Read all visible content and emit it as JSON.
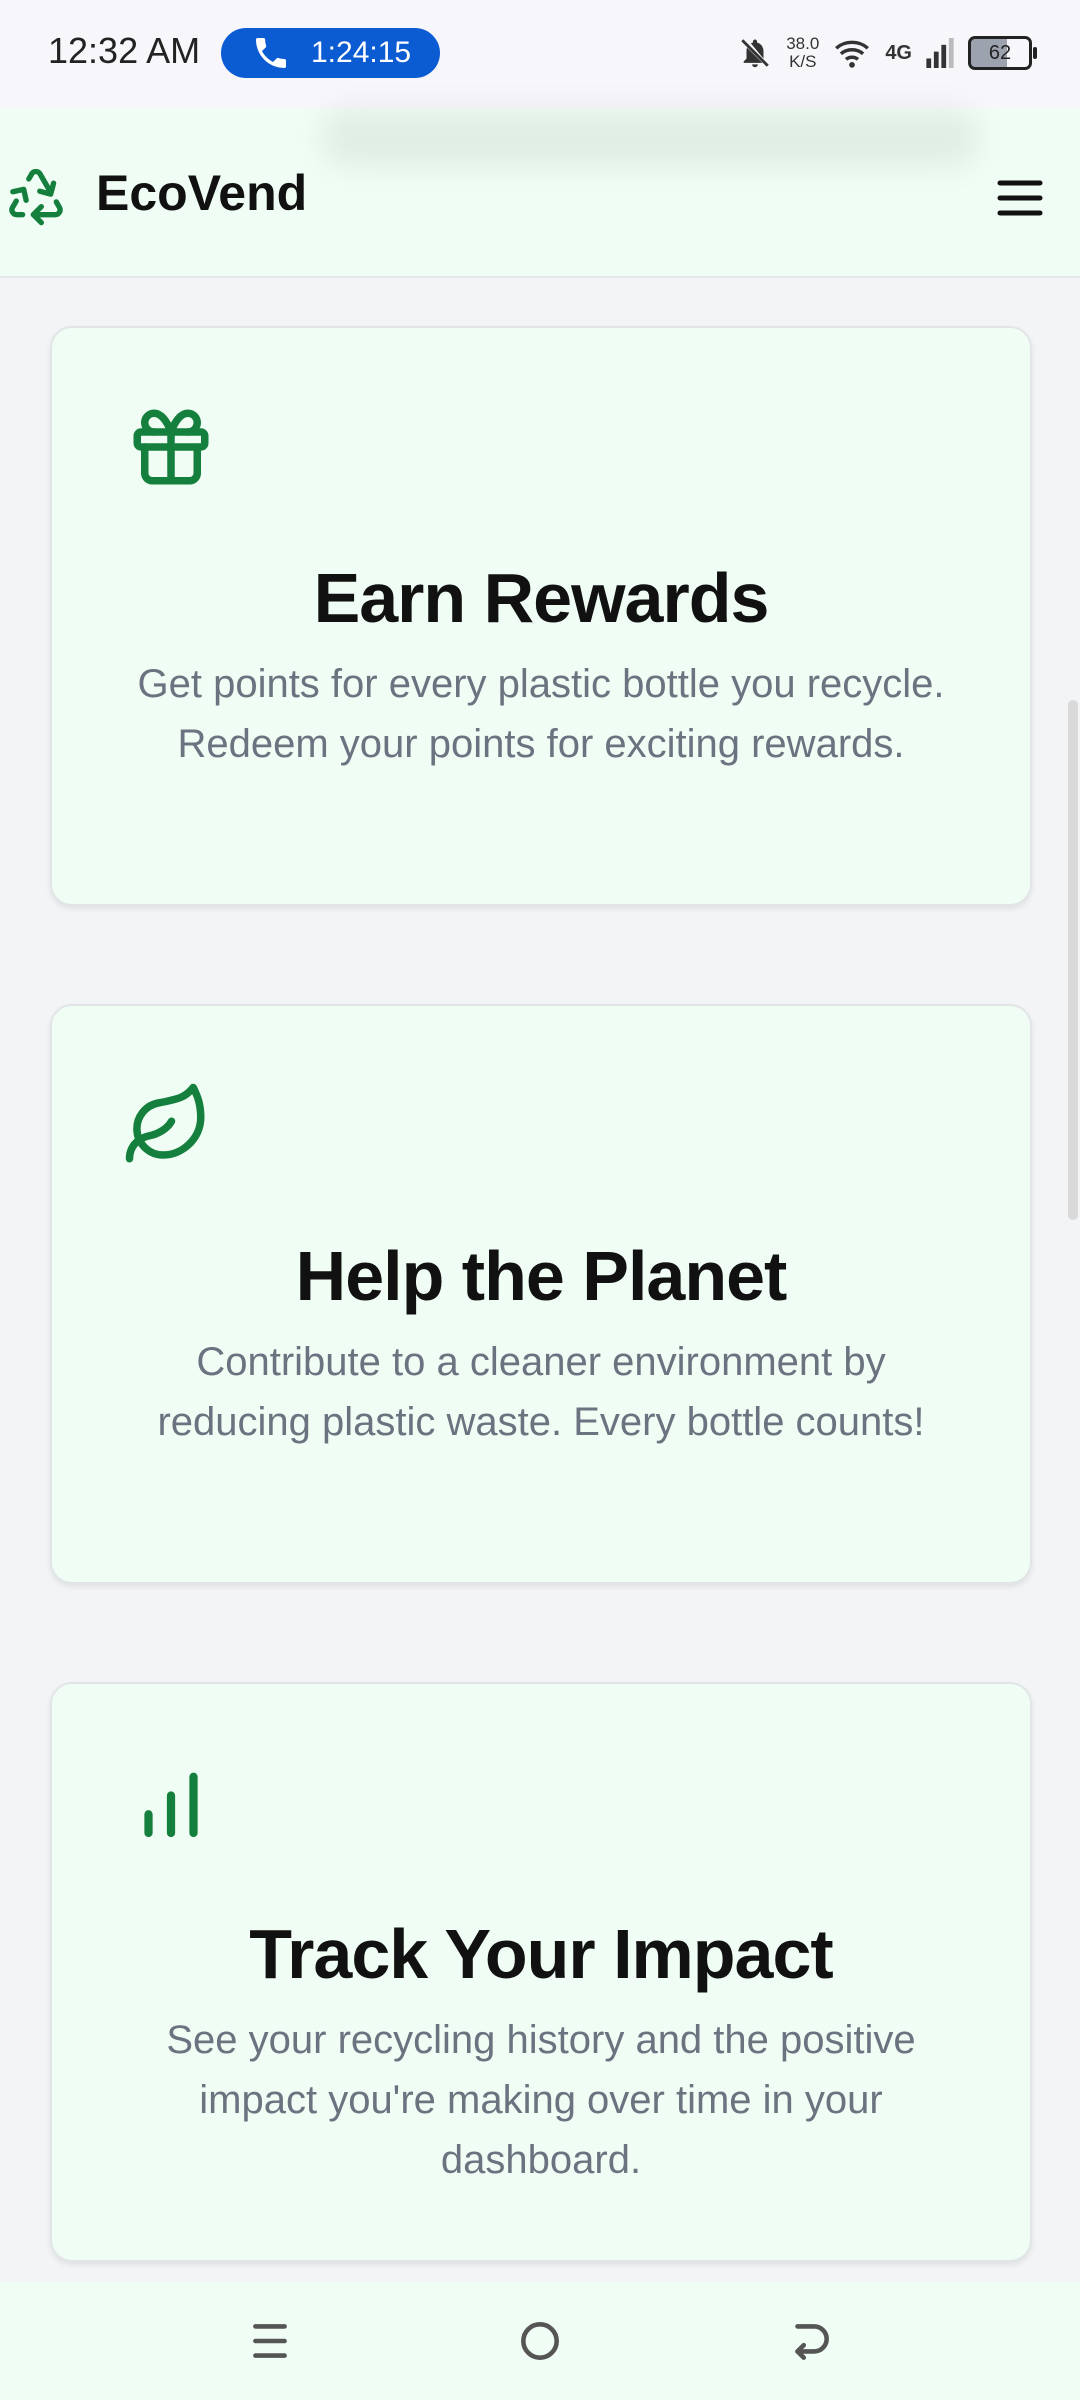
{
  "status_bar": {
    "time": "12:32 AM",
    "call_timer": "1:24:15",
    "net_speed_value": "38.0",
    "net_speed_unit": "K/S",
    "network_type": "4G",
    "battery_level": "62"
  },
  "header": {
    "brand": "EcoVend",
    "logo_icon": "recycle-icon",
    "menu_icon": "hamburger-menu-icon"
  },
  "cards": [
    {
      "icon": "gift-icon",
      "title": "Earn Rewards",
      "description": "Get points for every plastic bottle you recycle. Redeem your points for exciting rewards."
    },
    {
      "icon": "leaf-icon",
      "title": "Help the Planet",
      "description": "Contribute to a cleaner environment by reducing plastic waste. Every bottle counts!"
    },
    {
      "icon": "bar-chart-icon",
      "title": "Track Your Impact",
      "description": "See your recycling history and the positive impact you're making over time in your dashboard."
    }
  ],
  "colors": {
    "accent_green": "#15803d",
    "card_background": "#f0fdf4",
    "call_pill": "#0b5bd3"
  }
}
